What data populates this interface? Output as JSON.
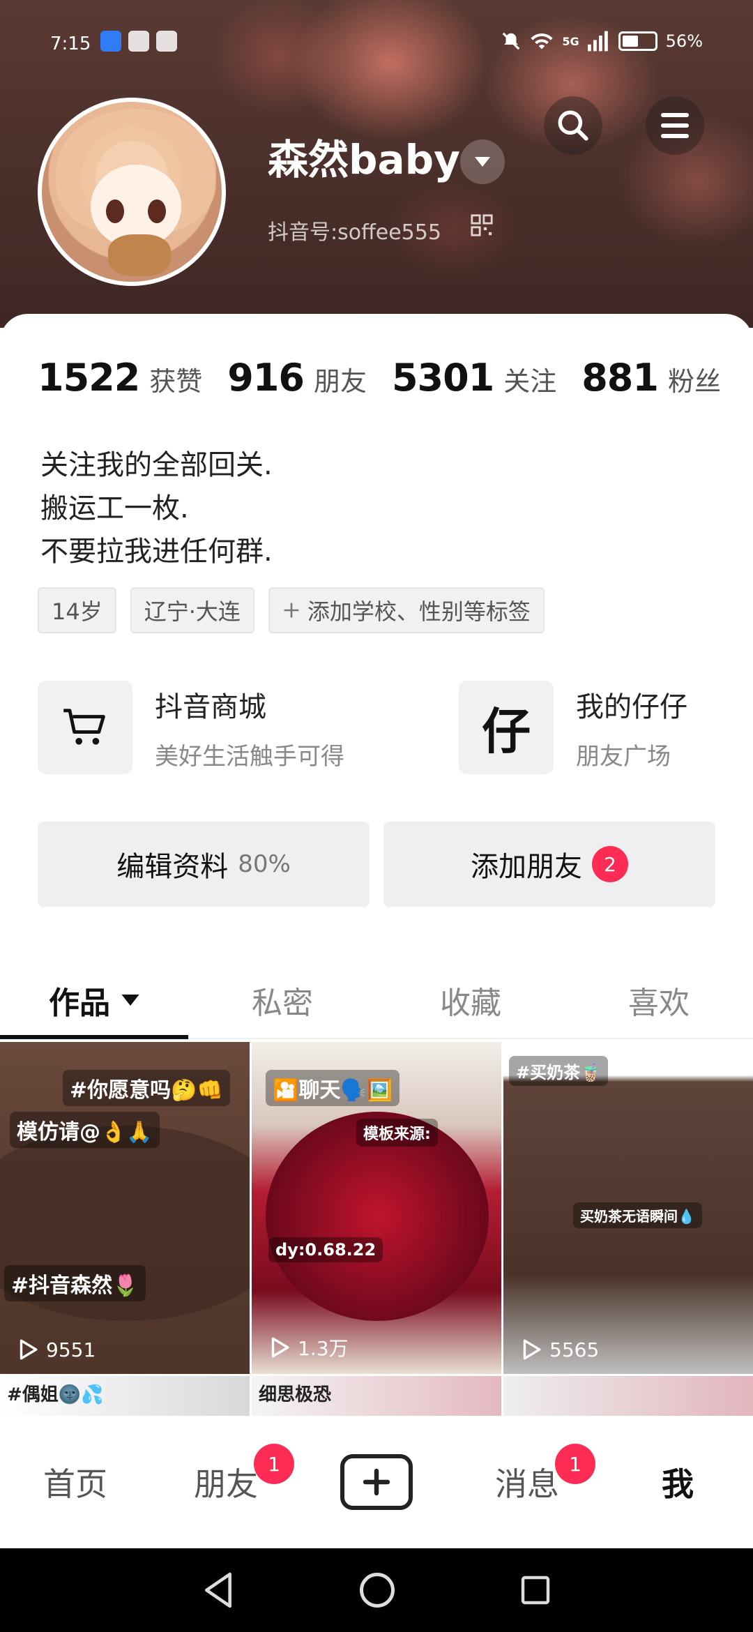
{
  "status_bar": {
    "time": "7:15",
    "network": "5G",
    "battery_level": 0.56,
    "battery_text": "56%"
  },
  "profile": {
    "name": "森然baby",
    "douyin_id": "抖音号:soffee555"
  },
  "stats": [
    {
      "value": "1522",
      "label": "获赞"
    },
    {
      "value": "916",
      "label": "朋友"
    },
    {
      "value": "5301",
      "label": "关注"
    },
    {
      "value": "881",
      "label": "粉丝"
    }
  ],
  "bio": [
    "关注我的全部回关.",
    "搬运工一枚.",
    "不要拉我进任何群."
  ],
  "tags": {
    "age": "14岁",
    "location": "辽宁·大连",
    "add_tag": "添加学校、性别等标签"
  },
  "services": {
    "mall": {
      "title": "抖音商城",
      "subtitle": "美好生活触手可得"
    },
    "zaizai": {
      "title": "我的仔仔",
      "subtitle": "朋友广场",
      "glyph": "仔"
    }
  },
  "actions": {
    "edit_label": "编辑资料",
    "edit_percent": "80%",
    "add_friend_label": "添加朋友",
    "add_friend_badge": "2"
  },
  "tabs": [
    "作品",
    "私密",
    "收藏",
    "喜欢"
  ],
  "videos": [
    {
      "caption_top": "#你愿意吗🤔👊",
      "caption_mid": "模仿请@👌🙏",
      "caption_bottom": "#抖音森然🌷",
      "plays": "9551"
    },
    {
      "caption_top": "🎦聊天🗣️🖼️",
      "caption_mid": "模板来源:",
      "caption_bottom": "dy:0.68.22",
      "plays": "1.3万"
    },
    {
      "caption_top": "#买奶茶🧋",
      "caption_mid": "买奶茶无语瞬间💧",
      "plays": "5565"
    }
  ],
  "videos_row2": [
    {
      "caption": "#偶姐🌚💦"
    },
    {
      "caption": "细思极恐"
    },
    {
      "caption": ""
    }
  ],
  "bottom_nav": {
    "home": "首页",
    "friends": "朋友",
    "friends_badge": "1",
    "messages": "消息",
    "messages_badge": "1",
    "me": "我"
  }
}
